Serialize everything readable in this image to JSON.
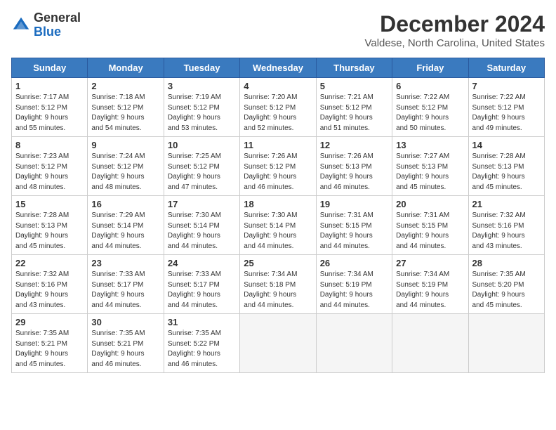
{
  "header": {
    "logo_general": "General",
    "logo_blue": "Blue",
    "month_title": "December 2024",
    "location": "Valdese, North Carolina, United States"
  },
  "weekdays": [
    "Sunday",
    "Monday",
    "Tuesday",
    "Wednesday",
    "Thursday",
    "Friday",
    "Saturday"
  ],
  "weeks": [
    [
      {
        "day": "1",
        "info": "Sunrise: 7:17 AM\nSunset: 5:12 PM\nDaylight: 9 hours\nand 55 minutes."
      },
      {
        "day": "2",
        "info": "Sunrise: 7:18 AM\nSunset: 5:12 PM\nDaylight: 9 hours\nand 54 minutes."
      },
      {
        "day": "3",
        "info": "Sunrise: 7:19 AM\nSunset: 5:12 PM\nDaylight: 9 hours\nand 53 minutes."
      },
      {
        "day": "4",
        "info": "Sunrise: 7:20 AM\nSunset: 5:12 PM\nDaylight: 9 hours\nand 52 minutes."
      },
      {
        "day": "5",
        "info": "Sunrise: 7:21 AM\nSunset: 5:12 PM\nDaylight: 9 hours\nand 51 minutes."
      },
      {
        "day": "6",
        "info": "Sunrise: 7:22 AM\nSunset: 5:12 PM\nDaylight: 9 hours\nand 50 minutes."
      },
      {
        "day": "7",
        "info": "Sunrise: 7:22 AM\nSunset: 5:12 PM\nDaylight: 9 hours\nand 49 minutes."
      }
    ],
    [
      {
        "day": "8",
        "info": "Sunrise: 7:23 AM\nSunset: 5:12 PM\nDaylight: 9 hours\nand 48 minutes."
      },
      {
        "day": "9",
        "info": "Sunrise: 7:24 AM\nSunset: 5:12 PM\nDaylight: 9 hours\nand 48 minutes."
      },
      {
        "day": "10",
        "info": "Sunrise: 7:25 AM\nSunset: 5:12 PM\nDaylight: 9 hours\nand 47 minutes."
      },
      {
        "day": "11",
        "info": "Sunrise: 7:26 AM\nSunset: 5:12 PM\nDaylight: 9 hours\nand 46 minutes."
      },
      {
        "day": "12",
        "info": "Sunrise: 7:26 AM\nSunset: 5:13 PM\nDaylight: 9 hours\nand 46 minutes."
      },
      {
        "day": "13",
        "info": "Sunrise: 7:27 AM\nSunset: 5:13 PM\nDaylight: 9 hours\nand 45 minutes."
      },
      {
        "day": "14",
        "info": "Sunrise: 7:28 AM\nSunset: 5:13 PM\nDaylight: 9 hours\nand 45 minutes."
      }
    ],
    [
      {
        "day": "15",
        "info": "Sunrise: 7:28 AM\nSunset: 5:13 PM\nDaylight: 9 hours\nand 45 minutes."
      },
      {
        "day": "16",
        "info": "Sunrise: 7:29 AM\nSunset: 5:14 PM\nDaylight: 9 hours\nand 44 minutes."
      },
      {
        "day": "17",
        "info": "Sunrise: 7:30 AM\nSunset: 5:14 PM\nDaylight: 9 hours\nand 44 minutes."
      },
      {
        "day": "18",
        "info": "Sunrise: 7:30 AM\nSunset: 5:14 PM\nDaylight: 9 hours\nand 44 minutes."
      },
      {
        "day": "19",
        "info": "Sunrise: 7:31 AM\nSunset: 5:15 PM\nDaylight: 9 hours\nand 44 minutes."
      },
      {
        "day": "20",
        "info": "Sunrise: 7:31 AM\nSunset: 5:15 PM\nDaylight: 9 hours\nand 44 minutes."
      },
      {
        "day": "21",
        "info": "Sunrise: 7:32 AM\nSunset: 5:16 PM\nDaylight: 9 hours\nand 43 minutes."
      }
    ],
    [
      {
        "day": "22",
        "info": "Sunrise: 7:32 AM\nSunset: 5:16 PM\nDaylight: 9 hours\nand 43 minutes."
      },
      {
        "day": "23",
        "info": "Sunrise: 7:33 AM\nSunset: 5:17 PM\nDaylight: 9 hours\nand 44 minutes."
      },
      {
        "day": "24",
        "info": "Sunrise: 7:33 AM\nSunset: 5:17 PM\nDaylight: 9 hours\nand 44 minutes."
      },
      {
        "day": "25",
        "info": "Sunrise: 7:34 AM\nSunset: 5:18 PM\nDaylight: 9 hours\nand 44 minutes."
      },
      {
        "day": "26",
        "info": "Sunrise: 7:34 AM\nSunset: 5:19 PM\nDaylight: 9 hours\nand 44 minutes."
      },
      {
        "day": "27",
        "info": "Sunrise: 7:34 AM\nSunset: 5:19 PM\nDaylight: 9 hours\nand 44 minutes."
      },
      {
        "day": "28",
        "info": "Sunrise: 7:35 AM\nSunset: 5:20 PM\nDaylight: 9 hours\nand 45 minutes."
      }
    ],
    [
      {
        "day": "29",
        "info": "Sunrise: 7:35 AM\nSunset: 5:21 PM\nDaylight: 9 hours\nand 45 minutes."
      },
      {
        "day": "30",
        "info": "Sunrise: 7:35 AM\nSunset: 5:21 PM\nDaylight: 9 hours\nand 46 minutes."
      },
      {
        "day": "31",
        "info": "Sunrise: 7:35 AM\nSunset: 5:22 PM\nDaylight: 9 hours\nand 46 minutes."
      },
      null,
      null,
      null,
      null
    ]
  ]
}
